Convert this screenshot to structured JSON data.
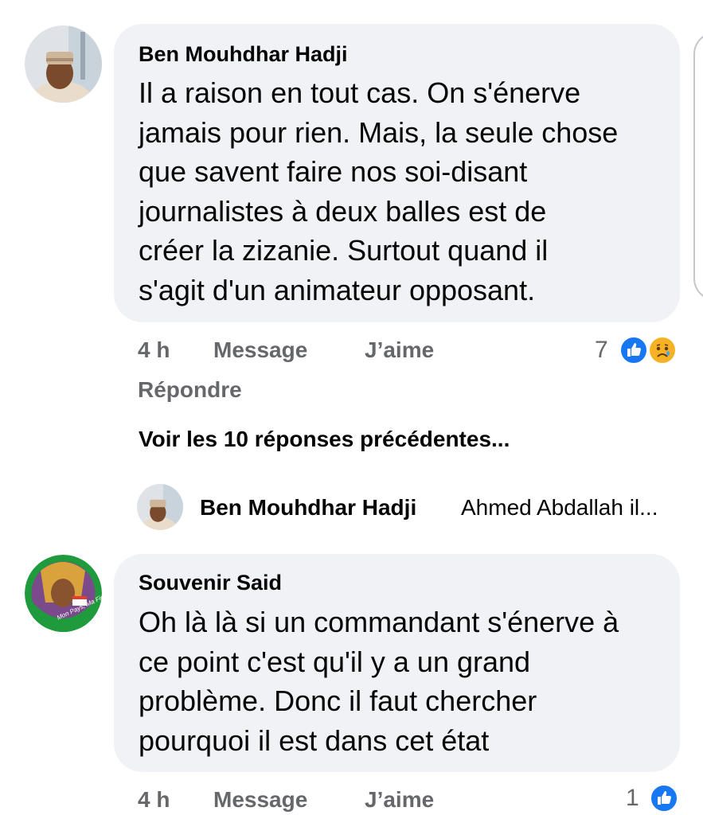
{
  "comments": [
    {
      "author": "Ben Mouhdhar Hadji",
      "lines": [
        "Il a raison en tout cas. On s'énerve",
        "jamais pour rien. Mais, la seule chose",
        "que savent faire nos soi-disant",
        "journalistes à deux balles est de",
        "créer la zizanie. Surtout quand il",
        "s'agit d'un animateur opposant."
      ],
      "time": "4 h",
      "message_label": "Message",
      "like_label": "J’aime",
      "reply_label": "Répondre",
      "reaction_count": "7",
      "reactions": [
        "like-icon",
        "sad-icon"
      ]
    },
    {
      "author": "Souvenir Said",
      "lines": [
        "Oh là là si un commandant s'énerve à",
        "ce point c'est qu'il y a un grand",
        "problème. Donc il faut chercher",
        "pourquoi il est dans cet état"
      ],
      "time": "4 h",
      "message_label": "Message",
      "like_label": "J’aime",
      "reaction_count": "1",
      "reactions": [
        "like-icon"
      ],
      "avatar_caption": "Mon Pays, Ma Fierté"
    }
  ],
  "view_previous_replies": "Voir les 10 réponses précédentes...",
  "reply_preview": {
    "author": "Ben Mouhdhar Hadji",
    "snippet": "Ahmed Abdallah il..."
  },
  "colors": {
    "bubble": "#f0f2f5",
    "meta_text": "#65676b",
    "like_blue": "#1877f2",
    "sad_yellow": "#f7b125"
  }
}
